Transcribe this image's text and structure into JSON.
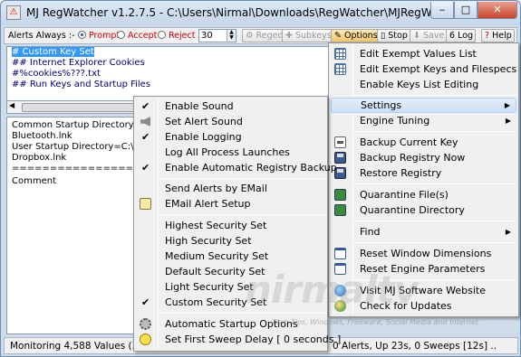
{
  "window": {
    "title": "MJ RegWatcher v1.2.7.5 - C:\\Users\\Nirmal\\Downloads\\RegWatcher\\MJRegWatcher\\MJReg...",
    "buttons": {
      "minimize": "‒",
      "maximize": "□",
      "close": "✕"
    }
  },
  "toolbar": {
    "alerts_label": "Alerts Always :-",
    "radio_prompt": "Prompt",
    "radio_accept": "Accept",
    "radio_reject": "Reject",
    "selected_mode": "Prompt",
    "interval_value": "30",
    "regedit": "Regedit",
    "subkeys": "Subkeys",
    "options": "Options",
    "stop": "Stop",
    "save": "Save",
    "log": "Log",
    "help": "Help"
  },
  "top_pane": {
    "lines": [
      "# Custom Key Set",
      "## Internet Explorer Cookies",
      "#%cookies%???.txt",
      "## Run Keys and Startup Files"
    ]
  },
  "bottom_pane": {
    "lines": [
      "Common Startup Directory=C:\\P",
      "Bluetooth.lnk",
      "User Startup Directory=C:\\Use",
      "Dropbox.lnk",
      "========================",
      "Comment"
    ]
  },
  "status": {
    "left": "Monitoring 4,588 Values (30",
    "right": "0 Alerts, Up 23s, 0 Sweeps [12s] .."
  },
  "options_menu": {
    "items": [
      {
        "label": "Edit Exempt Values List",
        "icon": "grid-icon"
      },
      {
        "label": "Edit Exempt Keys and Filespecs List",
        "icon": "grid-icon"
      },
      {
        "label": "Enable Keys List Editing",
        "icon": ""
      },
      {
        "label": "Settings",
        "submenu": true
      },
      {
        "label": "Engine Tuning",
        "submenu": true
      },
      {
        "label": "Backup Current Key",
        "icon": "key-icon"
      },
      {
        "label": "Backup Registry Now",
        "icon": "disk-icon"
      },
      {
        "label": "Restore Registry",
        "icon": "disk-icon"
      },
      {
        "label": "Quarantine File(s)",
        "icon": "quarantine-icon"
      },
      {
        "label": "Quarantine Directory",
        "icon": "quarantine-icon"
      },
      {
        "label": "Find",
        "submenu": true
      },
      {
        "label": "Reset Window Dimensions",
        "icon": "window-icon"
      },
      {
        "label": "Reset Engine Parameters",
        "icon": "window-icon"
      },
      {
        "label": "Visit MJ Software Website",
        "icon": "globe-icon"
      },
      {
        "label": "Check for Updates",
        "icon": "update-globe-icon"
      }
    ]
  },
  "settings_menu": {
    "items": [
      {
        "label": "Enable Sound",
        "checked": true
      },
      {
        "label": "Set Alert Sound",
        "checked": false
      },
      {
        "label": "Enable Logging",
        "checked": true
      },
      {
        "label": "Log All Process Launches",
        "checked": false
      },
      {
        "label": "Enable Automatic Registry Backup",
        "checked": true
      },
      {
        "label": "Send Alerts by EMail",
        "checked": false
      },
      {
        "label": "EMail Alert Setup",
        "checked": false
      },
      {
        "label": "Highest Security Set",
        "checked": false
      },
      {
        "label": "High Security Set",
        "checked": false
      },
      {
        "label": "Medium Security Set",
        "checked": false
      },
      {
        "label": "Default Security Set",
        "checked": false
      },
      {
        "label": "Light Security Set",
        "checked": false
      },
      {
        "label": "Custom Security Set",
        "checked": true
      },
      {
        "label": "Automatic Startup Options",
        "checked": false
      },
      {
        "label": "Set First Sweep Delay [ 0 seconds ]",
        "checked": false
      }
    ]
  },
  "watermark": {
    "brand": "nirmaltv",
    "tagline": "Tech Tips, Windows, Freeware, Social Media and Internet"
  }
}
